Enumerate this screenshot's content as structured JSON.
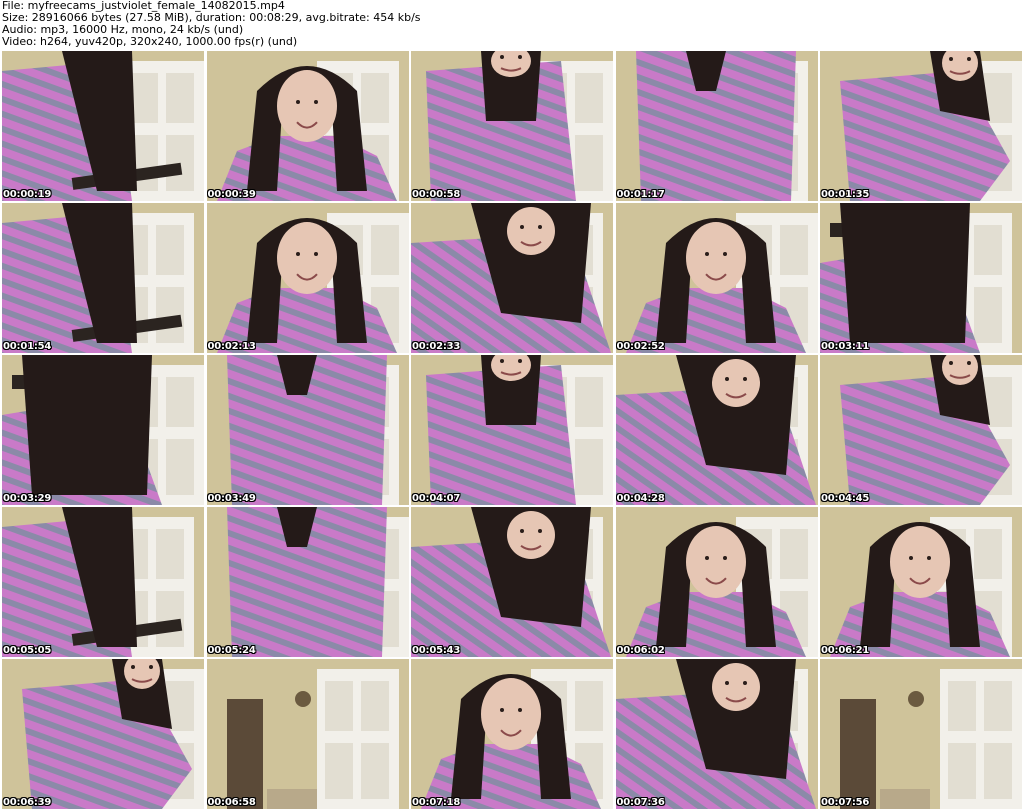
{
  "header": {
    "file_line": "File: myfreecams_justviolet_female_14082015.mp4",
    "size_line": "Size: 28916066 bytes (27.58 MiB), duration: 00:08:29, avg.bitrate: 454 kb/s",
    "audio_line": "Audio: mp3, 16000 Hz, mono, 24 kb/s (und)",
    "video_line": "Video: h264, yuv420p, 320x240, 1000.00 fps(r) (und)"
  },
  "thumbnails": [
    {
      "time": "00:00:19",
      "scene": "robe-iron"
    },
    {
      "time": "00:00:39",
      "scene": "face-smile"
    },
    {
      "time": "00:00:58",
      "scene": "robe-hands"
    },
    {
      "time": "00:01:17",
      "scene": "robe-torso"
    },
    {
      "time": "00:01:35",
      "scene": "robe-side"
    },
    {
      "time": "00:01:54",
      "scene": "robe-iron"
    },
    {
      "time": "00:02:13",
      "scene": "face-smile"
    },
    {
      "time": "00:02:33",
      "scene": "hair-blur"
    },
    {
      "time": "00:02:52",
      "scene": "face-smile"
    },
    {
      "time": "00:03:11",
      "scene": "hair-iron"
    },
    {
      "time": "00:03:29",
      "scene": "hair-iron"
    },
    {
      "time": "00:03:49",
      "scene": "robe-torso"
    },
    {
      "time": "00:04:07",
      "scene": "robe-hands"
    },
    {
      "time": "00:04:28",
      "scene": "hair-blur"
    },
    {
      "time": "00:04:45",
      "scene": "robe-side"
    },
    {
      "time": "00:05:05",
      "scene": "robe-iron"
    },
    {
      "time": "00:05:24",
      "scene": "robe-torso"
    },
    {
      "time": "00:05:43",
      "scene": "hair-blur"
    },
    {
      "time": "00:06:02",
      "scene": "face-smile"
    },
    {
      "time": "00:06:21",
      "scene": "face-smile"
    },
    {
      "time": "00:06:39",
      "scene": "robe-side"
    },
    {
      "time": "00:06:58",
      "scene": "room-empty"
    },
    {
      "time": "00:07:18",
      "scene": "face-smile"
    },
    {
      "time": "00:07:36",
      "scene": "hair-blur"
    },
    {
      "time": "00:07:56",
      "scene": "room-empty"
    }
  ],
  "colors": {
    "wall": "#cfc39a",
    "door": "#f2f0ea",
    "door_panel": "#e2ded2",
    "robe_pink": "#c97ac8",
    "robe_grey": "#8b8aa8",
    "hair": "#241a18",
    "skin": "#e6c6b4",
    "timestamp_text": "#ffffff",
    "timestamp_outline": "#000000"
  }
}
